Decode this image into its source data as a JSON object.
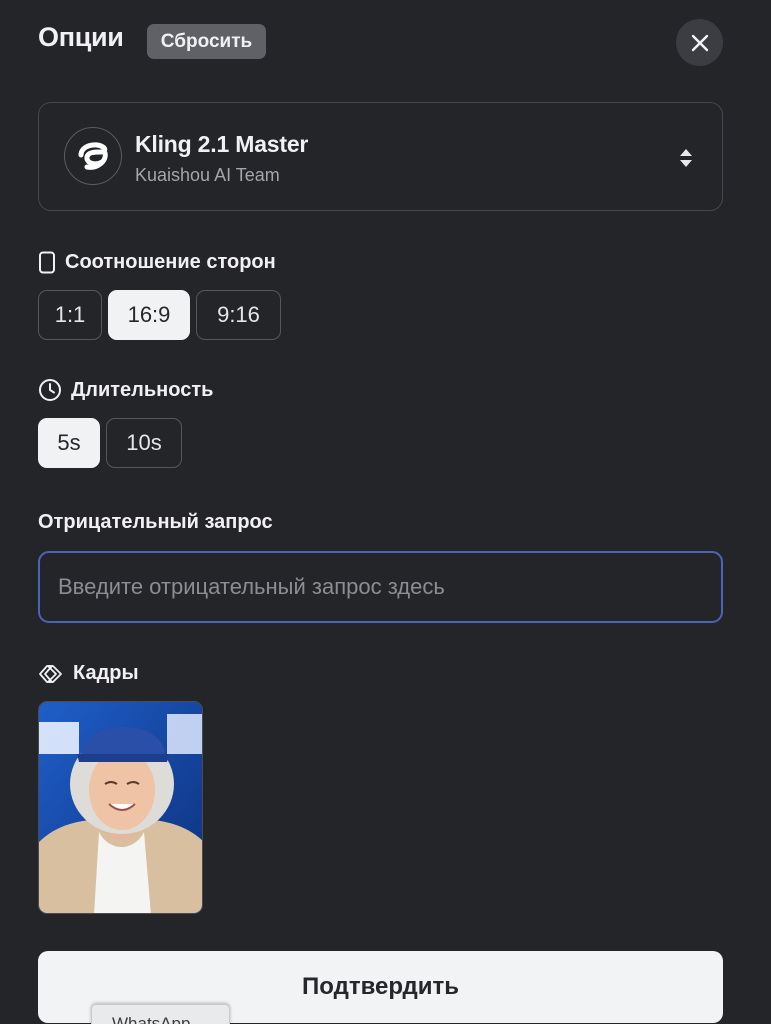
{
  "header": {
    "title": "Опции",
    "reset_label": "Сбросить",
    "close_icon": "close-icon"
  },
  "model": {
    "name": "Kling 2.1 Master",
    "vendor": "Kuaishou AI Team",
    "logo_icon": "kling-logo-icon",
    "selector_icon": "sort-arrows-icon"
  },
  "aspect_ratio": {
    "label": "Соотношение сторон",
    "icon": "phone-outline-icon",
    "options": [
      "1:1",
      "16:9",
      "9:16"
    ],
    "selected": "16:9"
  },
  "duration": {
    "label": "Длительность",
    "icon": "clock-icon",
    "options": [
      "5s",
      "10s"
    ],
    "selected": "5s"
  },
  "negative_prompt": {
    "label": "Отрицательный запрос",
    "value": "",
    "placeholder": "Введите отрицательный запрос здесь"
  },
  "frames": {
    "label": "Кадры",
    "icon": "frames-chevrons-icon",
    "items": [
      {
        "name": "frame-thumbnail",
        "description_icon": "portrait-image"
      }
    ]
  },
  "confirm_label": "Подтвердить",
  "tooltip": {
    "text": "WhatsApp"
  },
  "colors": {
    "background": "#242529",
    "accent_focus": "#4b63b8",
    "chip_active_bg": "#f1f2f4",
    "reset_bg": "#5f6167"
  }
}
